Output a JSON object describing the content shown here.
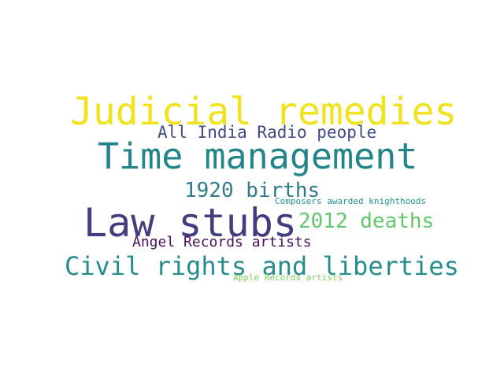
{
  "word_cloud": {
    "words": [
      {
        "text": "Judicial remedies",
        "color": "#f1e21c"
      },
      {
        "text": "All India Radio people",
        "color": "#3f4b87"
      },
      {
        "text": "Time management",
        "color": "#23858b"
      },
      {
        "text": "1920 births",
        "color": "#317a8e"
      },
      {
        "text": "Composers awarded knighthoods",
        "color": "#21938a"
      },
      {
        "text": "Law stubs",
        "color": "#453c80"
      },
      {
        "text": "2012 deaths",
        "color": "#5fc76a"
      },
      {
        "text": "Angel Records artists",
        "color": "#480f5e"
      },
      {
        "text": "Civil rights and liberties",
        "color": "#278c8c"
      },
      {
        "text": "Apple Records artists",
        "color": "#7ad15b"
      }
    ]
  }
}
